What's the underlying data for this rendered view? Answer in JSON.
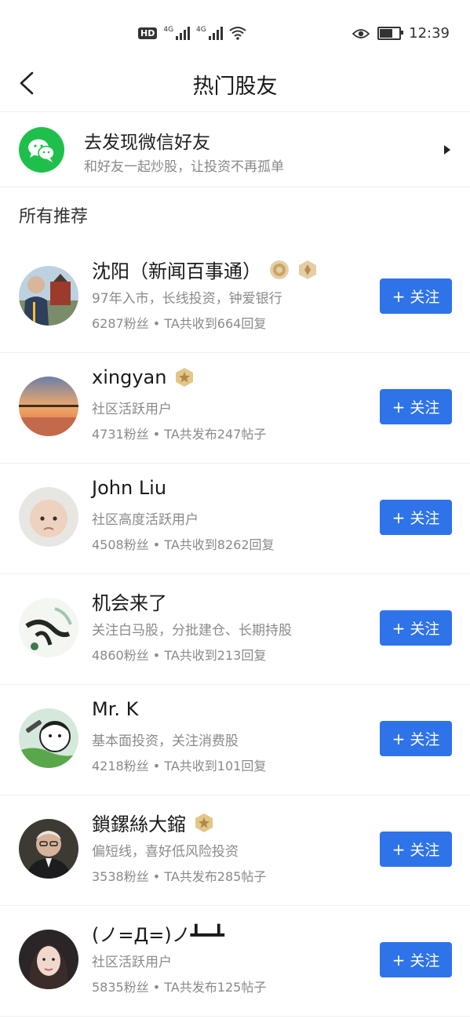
{
  "status_bar": {
    "hd": "HD",
    "network1": "4G",
    "network2": "4G",
    "time": "12:39",
    "battery_level": 0.62
  },
  "header": {
    "title": "热门股友"
  },
  "discover": {
    "title": "去发现微信好友",
    "subtitle": "和好友一起炒股，让投资不再孤单"
  },
  "section_label": "所有推荐",
  "follow_label": "关注",
  "users": [
    {
      "name": "沈阳（新闻百事通）",
      "desc": "97年入市，长线投资，钟爱银行",
      "stats": "6287粉丝 • TA共收到664回复",
      "avatar": "person-with-scene",
      "badges": [
        "medal-icon",
        "pen-badge-icon"
      ]
    },
    {
      "name": "xingyan",
      "desc": "社区活跃用户",
      "stats": "4731粉丝 • TA共发布247帖子",
      "avatar": "sunset-pier",
      "badges": [
        "star-badge-icon"
      ]
    },
    {
      "name": "John Liu",
      "desc": "社区高度活跃用户",
      "stats": "4508粉丝 • TA共收到8262回复",
      "avatar": "baby-face",
      "badges": []
    },
    {
      "name": "机会来了",
      "desc": "关注白马股，分批建仓、长期持股",
      "stats": "4860粉丝 • TA共收到213回复",
      "avatar": "calligraphy-art",
      "badges": []
    },
    {
      "name": "Mr. K",
      "desc": "基本面投资，关注消费股",
      "stats": "4218粉丝 • TA共收到101回复",
      "avatar": "cartoon-character",
      "badges": []
    },
    {
      "name": "鎖鏍絲大鏥",
      "desc": "偏短线，喜好低风险投资",
      "stats": "3538粉丝 • TA共发布285帖子",
      "avatar": "old-man-glasses",
      "badges": [
        "star-badge-icon"
      ]
    },
    {
      "name": "(ノ=Д=)ノ┻━┻",
      "desc": "社区活跃用户",
      "stats": "5835粉丝 • TA共发布125帖子",
      "avatar": "woman-portrait",
      "badges": []
    }
  ]
}
